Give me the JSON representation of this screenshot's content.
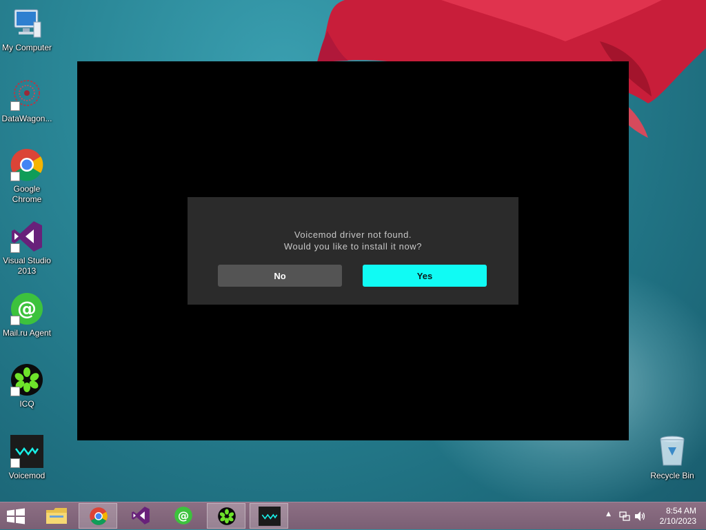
{
  "desktop": {
    "icons": [
      {
        "label": "My Computer"
      },
      {
        "label": "DataWagon..."
      },
      {
        "label": "Google Chrome"
      },
      {
        "label": "Visual Studio 2013"
      },
      {
        "label": "Mail.ru Agent"
      },
      {
        "label": "ICQ"
      },
      {
        "label": "Voicemod"
      },
      {
        "label": "Recycle Bin"
      }
    ]
  },
  "dialog": {
    "line1": "Voicemod driver not found.",
    "line2": "Would you like to install it now?",
    "no_label": "No",
    "yes_label": "Yes",
    "colors": {
      "yes_bg": "#10fbf4",
      "no_bg": "#545454",
      "dialog_bg": "#2b2b2b"
    }
  },
  "taskbar": {
    "items": [
      "file-explorer-icon",
      "chrome-icon",
      "visual-studio-icon",
      "mailru-agent-icon",
      "icq-icon",
      "voicemod-icon"
    ],
    "clock": {
      "time": "8:54 AM",
      "date": "2/10/2023"
    }
  }
}
